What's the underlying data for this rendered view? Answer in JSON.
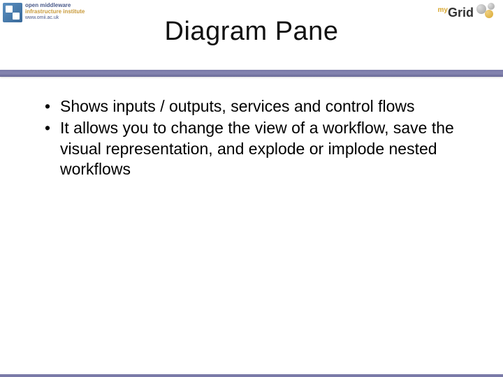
{
  "header": {
    "leftLogo": {
      "line1": "open middleware",
      "line2": "infrastructure institute",
      "line3": "www.omii.ac.uk"
    },
    "rightLogo": {
      "prefix": "my",
      "main": "Grid"
    },
    "title": "Diagram Pane"
  },
  "bullets": [
    "Shows inputs / outputs, services and control flows",
    "It allows you to change the view of a workflow, save the visual representation, and explode or implode nested workflows"
  ]
}
